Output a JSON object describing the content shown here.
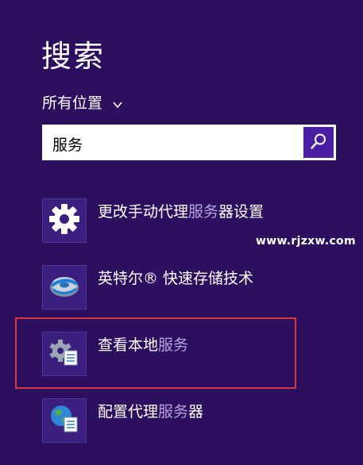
{
  "header": {
    "title": "搜索"
  },
  "scope": {
    "label": "所有位置",
    "icon": "chevron-down-icon"
  },
  "search": {
    "value": "服务",
    "button_icon": "search-icon"
  },
  "results": [
    {
      "pre": "更改手动代理",
      "match": "服务",
      "post": "器设置",
      "icon": "gear-icon"
    },
    {
      "pre": "英特尔® 快速存储技术",
      "match": "",
      "post": "",
      "icon": "intel-storage-icon"
    },
    {
      "pre": "查看本地",
      "match": "服务",
      "post": "",
      "icon": "services-icon"
    },
    {
      "pre": "配置代理",
      "match": "服务",
      "post": "器",
      "icon": "globe-proxy-icon"
    }
  ],
  "watermark": "www.rjzxw.com",
  "colors": {
    "background": "#2d0f60",
    "accent": "#4a1fa4",
    "match_text": "#b7a3dc",
    "annotation_border": "#d9363e"
  }
}
